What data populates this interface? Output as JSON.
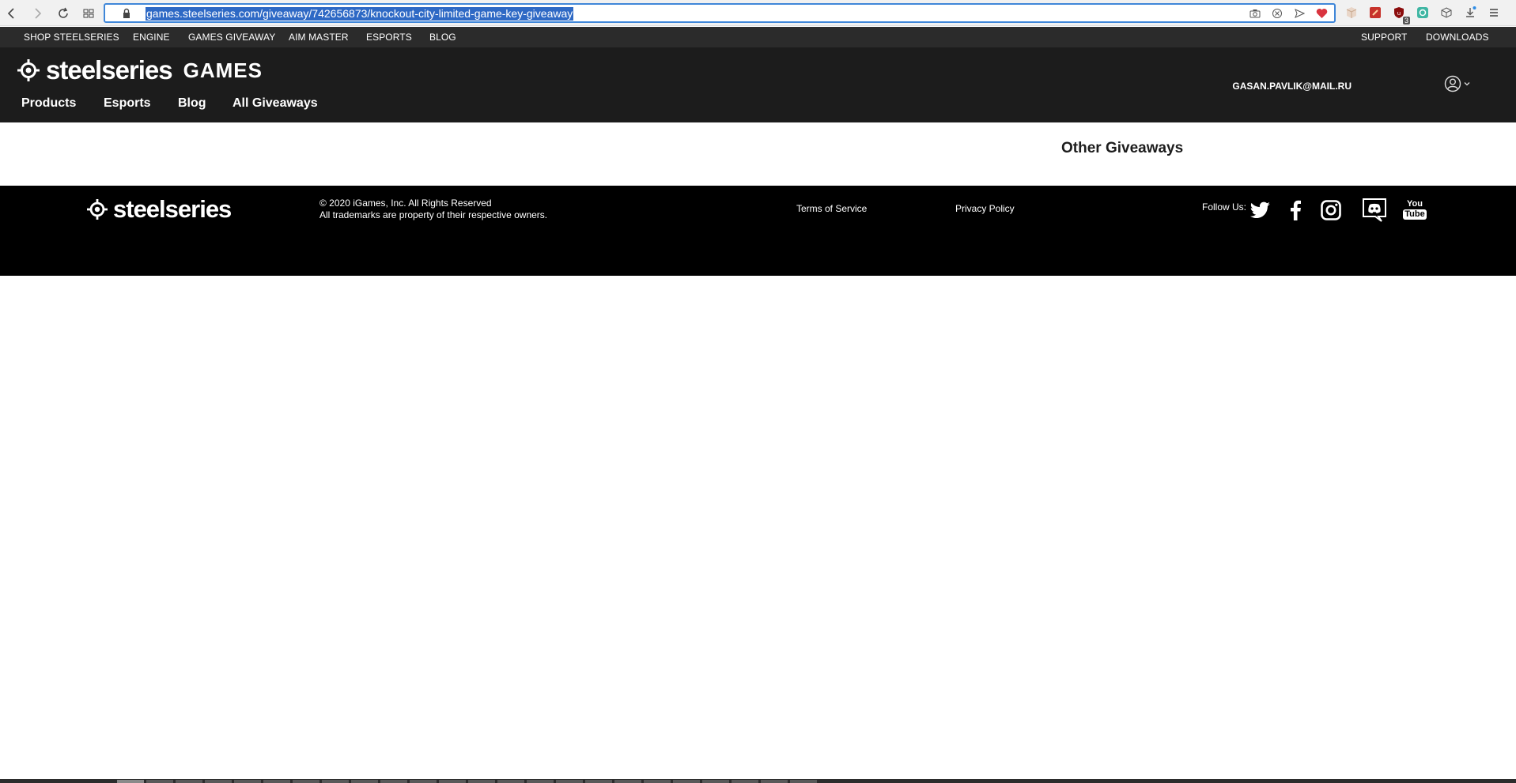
{
  "browser": {
    "url": "games.steelseries.com/giveaway/742656873/knockout-city-limited-game-key-giveaway",
    "extension_badge": "3"
  },
  "utility_nav": {
    "items": [
      "SHOP STEELSERIES",
      "ENGINE",
      "GAMES GIVEAWAY",
      "AIM MASTER",
      "ESPORTS",
      "BLOG"
    ],
    "right_items": [
      "SUPPORT",
      "DOWNLOADS"
    ]
  },
  "header": {
    "brand_wordmark": "steelseries",
    "brand_suffix": "GAMES",
    "user_email": "GASAN.PAVLIK@MAIL.RU",
    "nav": [
      "Products",
      "Esports",
      "Blog",
      "All Giveaways"
    ]
  },
  "content": {
    "other_giveaways_title": "Other Giveaways"
  },
  "footer": {
    "brand_wordmark": "steelseries",
    "copyright_line1": "© 2020 iGames, Inc. All Rights Reserved",
    "copyright_line2": "All trademarks are property of their respective owners.",
    "terms": "Terms of Service",
    "privacy": "Privacy Policy",
    "follow_label": "Follow Us:",
    "youtube_top": "You",
    "youtube_bottom": "Tube"
  },
  "colors": {
    "utility_bg": "#2b2b2b",
    "header_bg": "#1c1c1c",
    "footer_bg": "#000000",
    "url_highlight": "#2e69c5"
  }
}
